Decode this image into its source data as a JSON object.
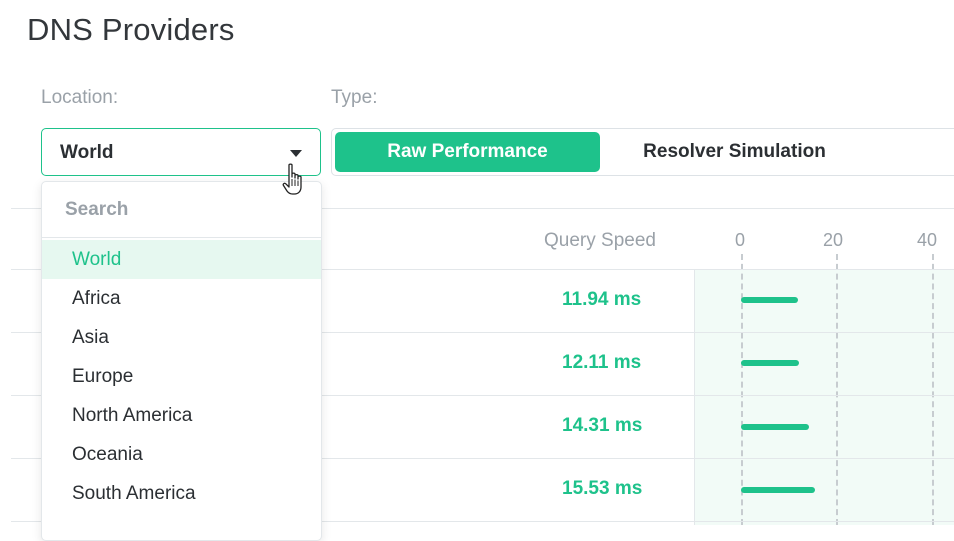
{
  "page": {
    "title": "DNS Providers"
  },
  "filters": {
    "location_label": "Location:",
    "type_label": "Type:",
    "location_selected": "World",
    "type_options": [
      "Raw Performance",
      "Resolver Simulation"
    ],
    "type_active": "Raw Performance"
  },
  "dropdown": {
    "search_placeholder": "Search",
    "options": [
      "World",
      "Africa",
      "Asia",
      "Europe",
      "North America",
      "Oceania",
      "South America"
    ],
    "selected": "World"
  },
  "table": {
    "header": {
      "query_speed": "Query Speed"
    },
    "axis_ticks": [
      "0",
      "20",
      "40"
    ],
    "rows": [
      {
        "speed": "11.94 ms",
        "value": 11.94
      },
      {
        "speed": "12.11 ms",
        "value": 12.11
      },
      {
        "speed": "14.31 ms",
        "value": 14.31
      },
      {
        "speed": "15.53 ms",
        "value": 15.53
      }
    ]
  },
  "colors": {
    "accent": "#1ec28b",
    "selected_bg": "#e6f8f0",
    "muted": "#9aa1a8"
  },
  "icons": {
    "caret": "caret-down-icon",
    "cursor": "hand-pointer-icon"
  }
}
